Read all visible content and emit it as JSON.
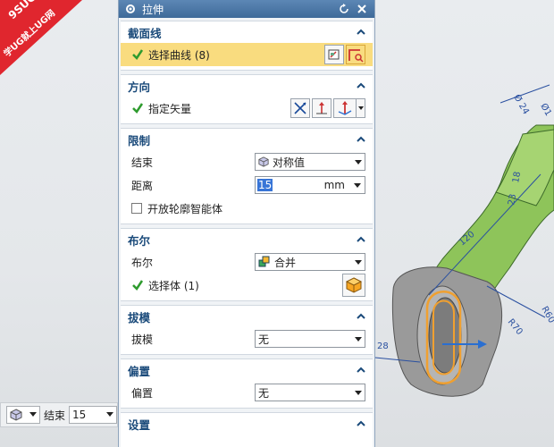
{
  "badge": {
    "line1": "9SUG",
    "line2": "学UG就上UG网"
  },
  "dialog": {
    "title": "拉伸",
    "sections": {
      "section_curve": {
        "title": "截面线",
        "select_curve": "选择曲线 (8)"
      },
      "direction": {
        "title": "方向",
        "specify_vector": "指定矢量"
      },
      "limits": {
        "title": "限制",
        "end_label": "结束",
        "end_value": "对称值",
        "distance_label": "距离",
        "distance_value": "15",
        "distance_unit": "mm",
        "open_profile": "开放轮廓智能体"
      },
      "boolean": {
        "title": "布尔",
        "boolean_label": "布尔",
        "boolean_value": "合并",
        "select_body": "选择体 (1)"
      },
      "draft": {
        "title": "拔模",
        "draft_label": "拔模",
        "draft_value": "无"
      },
      "offset": {
        "title": "偏置",
        "offset_label": "偏置",
        "offset_value": "无"
      },
      "settings": {
        "title": "设置"
      }
    }
  },
  "mini_toolbar": {
    "end_label": "结束",
    "end_value": "15"
  },
  "viewport_dims": [
    "Ø 24",
    "Ø1",
    "120",
    "18",
    "23",
    "R70",
    "R60",
    "28"
  ],
  "colors": {
    "title_bar": "#4a76a8",
    "section_head": "#1a4a7a",
    "highlight": "#f9dc7f",
    "part_green": "#8ec45a",
    "part_gray": "#9a9a9a",
    "curve_orange": "#f0a030"
  }
}
